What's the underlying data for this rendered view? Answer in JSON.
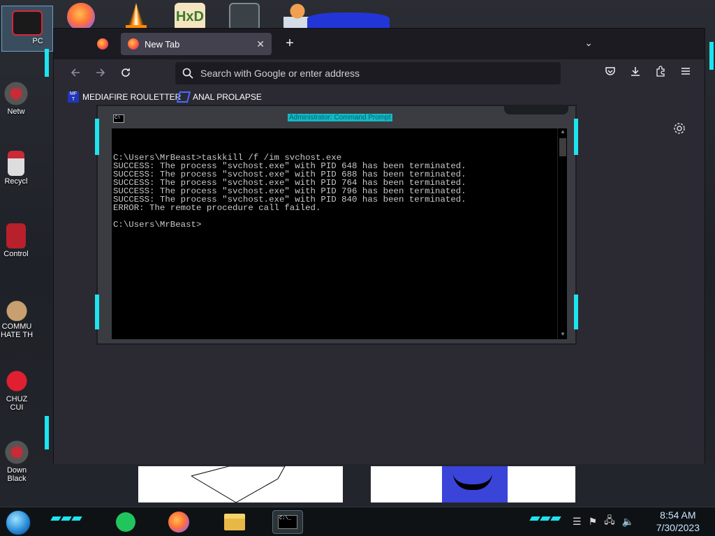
{
  "desktop": {
    "icons": [
      {
        "label": "PC",
        "icon": "computer-icon"
      },
      {
        "label": "Netw",
        "icon": "network-icon"
      },
      {
        "label": "Recycl",
        "icon": "recycle-bin-icon"
      },
      {
        "label": "Control",
        "icon": "control-panel-icon"
      },
      {
        "label": "COMMU HATE TH",
        "icon": "money-bag-icon"
      },
      {
        "label": "CHUZ CUI",
        "icon": "red-character-icon"
      },
      {
        "label": "Down Black",
        "icon": "download-icon"
      }
    ],
    "top_icons": [
      "firefox-icon",
      "vlc-icon",
      "hxd-icon",
      "app-icon",
      "user-icon"
    ]
  },
  "browser": {
    "pinned_tab_icon": "firefox-icon",
    "active_tab": {
      "label": "New Tab",
      "close": "✕"
    },
    "new_tab_symbol": "+",
    "list_all_tabs_symbol": "⌄",
    "address_placeholder": "Search with Google or enter address",
    "bookmarks": [
      {
        "label": "MEDIAFIRE ROULETTER",
        "icon_text": "MF T"
      },
      {
        "label": "ANAL PROLAPSE"
      }
    ]
  },
  "cmd": {
    "title": "Administrator: Command Prompt",
    "icon_text": "C:\\",
    "lines": [
      "C:\\Users\\MrBeast>taskkill /f /im svchost.exe",
      "SUCCESS: The process \"svchost.exe\" with PID 648 has been terminated.",
      "SUCCESS: The process \"svchost.exe\" with PID 688 has been terminated.",
      "SUCCESS: The process \"svchost.exe\" with PID 764 has been terminated.",
      "SUCCESS: The process \"svchost.exe\" with PID 796 has been terminated.",
      "SUCCESS: The process \"svchost.exe\" with PID 840 has been terminated.",
      "ERROR: The remote procedure call failed.",
      "",
      "C:\\Users\\MrBeast>"
    ]
  },
  "taskbar": {
    "apps": [
      "notes-icon",
      "firefox-icon",
      "file-explorer-icon",
      "command-prompt-icon"
    ],
    "cmd_icon_text": "C:\\_",
    "time": "8:54 AM",
    "date": "7/30/2023"
  },
  "colors": {
    "accent_cyan": "#1de4ef",
    "firefox_dark": "#2b2a33",
    "console_bg": "#000000",
    "console_text": "#c8c8c8"
  }
}
